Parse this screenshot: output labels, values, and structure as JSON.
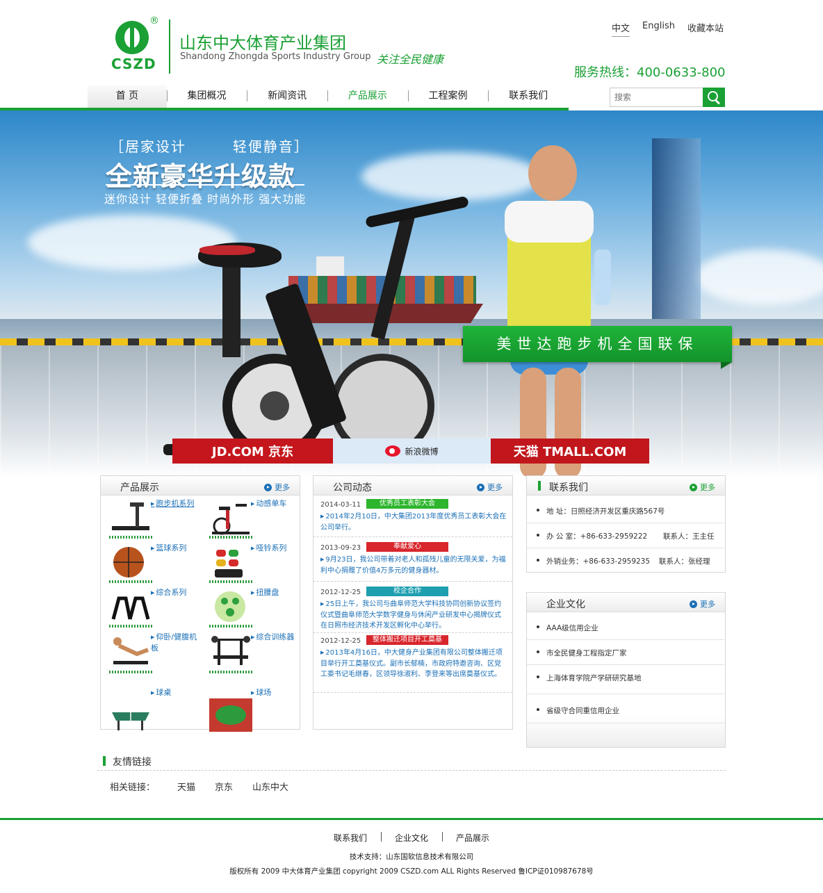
{
  "brand": {
    "abbr": "CSZD",
    "reg": "®",
    "name_cn": "山东中大体育产业集团",
    "name_en": "Shandong Zhongda Sports Industry Group",
    "slogan": "关注全民健康",
    "color": "#1aa034"
  },
  "top_links": [
    {
      "label": "中文",
      "active": true
    },
    {
      "label": "English",
      "active": false
    },
    {
      "label": "收藏本站",
      "active": false
    }
  ],
  "hotline": "服务热线：400-0633-800",
  "nav": [
    "首 页",
    "集团概况",
    "新闻资讯",
    "产品展示",
    "工程案例",
    "联系我们"
  ],
  "search": {
    "placeholder": "搜索",
    "icon": "search-icon"
  },
  "banner": {
    "tag_left": "［居家设计",
    "tag_right": "轻便静音］",
    "title": "全新豪华升级款",
    "sub": "迷你设计  轻便折叠    时尚外形  强大功能",
    "ribbon": "美世达跑步机全国联保",
    "shops": {
      "jd": "JD.COM 京东",
      "weibo": "新浪微博",
      "tmall": "天猫 TMALL.COM"
    }
  },
  "products": {
    "title": "产品展示",
    "more": "更多",
    "items": [
      "跑步机系列",
      "动感单车",
      "篮球系列",
      "哑铃系列",
      "综合系列",
      "扭腰盘",
      "仰卧/健腹机板",
      "综合训练器",
      "球桌",
      "球场"
    ]
  },
  "news": {
    "title": "公司动态",
    "more": "更多",
    "items": [
      {
        "date": "2014-03-11",
        "tag": "优秀员工表彰大会",
        "tag_color": "#2db52d",
        "text": "2014年2月10日，中大集团2013年度优秀员工表彰大会在公司举行。"
      },
      {
        "date": "2013-09-23",
        "tag": "奉献爱心",
        "tag_color": "#d8262c",
        "text": "9月23日，我公司带着对老人和孤残儿童的无限关爱，为福利中心捐赠了价值4万多元的健身器材。"
      },
      {
        "date": "2012-12-25",
        "tag": "校企合作",
        "tag_color": "#1e9fb0",
        "text": "25日上午，我公司与曲阜师范大学科技协同创新协议签约仪式暨曲阜师范大学数字健身与休闲产业研发中心揭牌仪式在日照市经济技术开发区孵化中心举行。"
      },
      {
        "date": "2012-12-25",
        "tag": "整体搬迁项目开工奠基",
        "tag_color": "#d8262c",
        "text": "2013年4月16日，中大健身产业集团有限公司整体搬迁项目举行开工奠基仪式。副市长郁楠，市政府特邀咨询、区党工委书记毛继春，区领导徐淑利、李登来等出席奠基仪式。"
      }
    ]
  },
  "contact": {
    "title": "联系我们",
    "more": "更多",
    "rows": [
      {
        "a": "地    址：日照经济开发区重庆路567号",
        "b": ""
      },
      {
        "a": "办 公 室：+86-633-2959222",
        "b": "联系人：王主任"
      },
      {
        "a": "外销业务：+86-633-2959235",
        "b": "联系人：张经理"
      }
    ]
  },
  "culture": {
    "title": "企业文化",
    "more": "更多",
    "items": [
      "AAA级信用企业",
      "市全民健身工程指定厂家",
      "上海体育学院产学研研究基地",
      "省级守合同重信用企业"
    ]
  },
  "links": {
    "title": "友情链接",
    "label": "相关链接：",
    "items": [
      "天猫",
      "京东",
      "山东中大"
    ]
  },
  "footer": {
    "links": [
      "联系我们",
      "企业文化",
      "产品展示"
    ],
    "tech": "技术支持：山东国软信息技术有限公司",
    "copyright": "版权所有  2009 中大体育产业集团 copyright  2009 CSZD.com ALL Rights Reserved 鲁ICP证010987678号"
  }
}
